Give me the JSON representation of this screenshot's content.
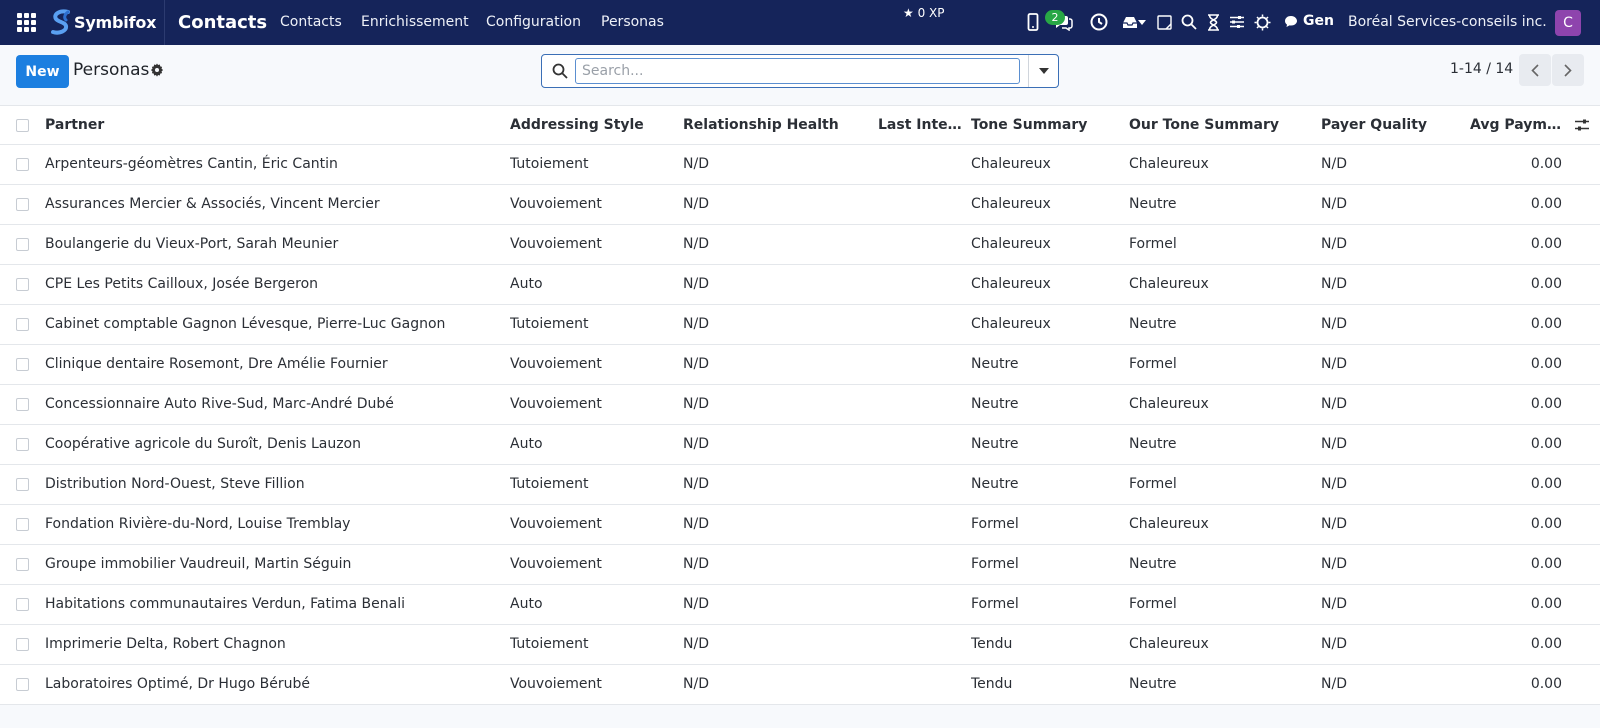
{
  "navbar": {
    "brand": "Symbifox",
    "app_title": "Contacts",
    "menu": [
      "Contacts",
      "Enrichissement",
      "Configuration",
      "Personas"
    ],
    "xp": "0 XP",
    "chat_badge": "2",
    "gen_label": "Gen",
    "company": "Boréal Services-conseils inc.",
    "avatar_letter": "C",
    "avatar_color": "#8e44ad"
  },
  "control": {
    "new_label": "New",
    "breadcrumb": "Personas",
    "search_placeholder": "Search...",
    "pager_value": "1-14 / 14"
  },
  "table": {
    "headers": {
      "partner": "Partner",
      "addressing_style": "Addressing Style",
      "relationship_health": "Relationship Health",
      "last_interaction": "Last Inter…",
      "tone_summary": "Tone Summary",
      "our_tone_summary": "Our Tone Summary",
      "payer_quality": "Payer Quality",
      "avg_payment": "Avg Payme…"
    },
    "rows": [
      {
        "partner": "Arpenteurs-géomètres Cantin, Éric Cantin",
        "style": "Tutoiement",
        "health": "N/D",
        "last": "",
        "tone": "Chaleureux",
        "our": "Chaleureux",
        "payer": "N/D",
        "avg": "0.00"
      },
      {
        "partner": "Assurances Mercier & Associés, Vincent Mercier",
        "style": "Vouvoiement",
        "health": "N/D",
        "last": "",
        "tone": "Chaleureux",
        "our": "Neutre",
        "payer": "N/D",
        "avg": "0.00"
      },
      {
        "partner": "Boulangerie du Vieux-Port, Sarah Meunier",
        "style": "Vouvoiement",
        "health": "N/D",
        "last": "",
        "tone": "Chaleureux",
        "our": "Formel",
        "payer": "N/D",
        "avg": "0.00"
      },
      {
        "partner": "CPE Les Petits Cailloux, Josée Bergeron",
        "style": "Auto",
        "health": "N/D",
        "last": "",
        "tone": "Chaleureux",
        "our": "Chaleureux",
        "payer": "N/D",
        "avg": "0.00"
      },
      {
        "partner": "Cabinet comptable Gagnon Lévesque, Pierre-Luc Gagnon",
        "style": "Tutoiement",
        "health": "N/D",
        "last": "",
        "tone": "Chaleureux",
        "our": "Neutre",
        "payer": "N/D",
        "avg": "0.00"
      },
      {
        "partner": "Clinique dentaire Rosemont, Dre Amélie Fournier",
        "style": "Vouvoiement",
        "health": "N/D",
        "last": "",
        "tone": "Neutre",
        "our": "Formel",
        "payer": "N/D",
        "avg": "0.00"
      },
      {
        "partner": "Concessionnaire Auto Rive-Sud, Marc-André Dubé",
        "style": "Vouvoiement",
        "health": "N/D",
        "last": "",
        "tone": "Neutre",
        "our": "Chaleureux",
        "payer": "N/D",
        "avg": "0.00"
      },
      {
        "partner": "Coopérative agricole du Suroît, Denis Lauzon",
        "style": "Auto",
        "health": "N/D",
        "last": "",
        "tone": "Neutre",
        "our": "Neutre",
        "payer": "N/D",
        "avg": "0.00"
      },
      {
        "partner": "Distribution Nord-Ouest, Steve Fillion",
        "style": "Tutoiement",
        "health": "N/D",
        "last": "",
        "tone": "Neutre",
        "our": "Formel",
        "payer": "N/D",
        "avg": "0.00"
      },
      {
        "partner": "Fondation Rivière-du-Nord, Louise Tremblay",
        "style": "Vouvoiement",
        "health": "N/D",
        "last": "",
        "tone": "Formel",
        "our": "Chaleureux",
        "payer": "N/D",
        "avg": "0.00"
      },
      {
        "partner": "Groupe immobilier Vaudreuil, Martin Séguin",
        "style": "Vouvoiement",
        "health": "N/D",
        "last": "",
        "tone": "Formel",
        "our": "Neutre",
        "payer": "N/D",
        "avg": "0.00"
      },
      {
        "partner": "Habitations communautaires Verdun, Fatima Benali",
        "style": "Auto",
        "health": "N/D",
        "last": "",
        "tone": "Formel",
        "our": "Formel",
        "payer": "N/D",
        "avg": "0.00"
      },
      {
        "partner": "Imprimerie Delta, Robert Chagnon",
        "style": "Tutoiement",
        "health": "N/D",
        "last": "",
        "tone": "Tendu",
        "our": "Chaleureux",
        "payer": "N/D",
        "avg": "0.00"
      },
      {
        "partner": "Laboratoires Optimé, Dr Hugo Bérubé",
        "style": "Vouvoiement",
        "health": "N/D",
        "last": "",
        "tone": "Tendu",
        "our": "Neutre",
        "payer": "N/D",
        "avg": "0.00"
      }
    ]
  },
  "colors": {
    "navbar_bg": "#15245a",
    "primary": "#1c7fe0",
    "badge": "#28a745"
  }
}
